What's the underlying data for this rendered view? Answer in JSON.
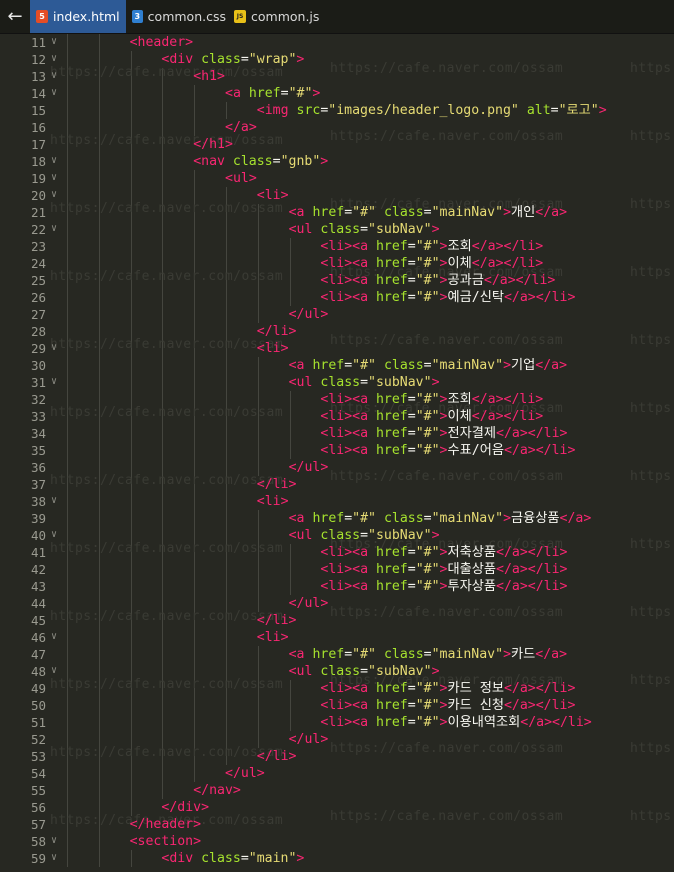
{
  "nav": {
    "back_glyph": "←"
  },
  "tabs": [
    {
      "name": "index.html",
      "icon": "html5-icon",
      "color": "#e44d26",
      "active": true
    },
    {
      "name": "common.css",
      "icon": "css3-icon",
      "color": "#2f7fd0",
      "active": false
    },
    {
      "name": "common.js",
      "icon": "js-icon",
      "color": "#e8c018",
      "active": false
    }
  ],
  "watermark": "https://cafe.naver.com/ossam",
  "colors": {
    "background": "#272822",
    "tag": "#f92672",
    "attribute": "#a6e22e",
    "string": "#e6db74",
    "text": "#f8f8f2",
    "active_tab": "#2d5a96"
  },
  "lines": [
    {
      "no": "11",
      "indent": 2,
      "fold": true,
      "tokens": [
        [
          "t",
          "<header>"
        ]
      ]
    },
    {
      "no": "12",
      "indent": 3,
      "fold": true,
      "tokens": [
        [
          "t",
          "<div"
        ],
        [
          "p",
          " "
        ],
        [
          "a",
          "class"
        ],
        [
          "p",
          "="
        ],
        [
          "s",
          "\"wrap\""
        ],
        [
          "t",
          ">"
        ]
      ]
    },
    {
      "no": "13",
      "indent": 4,
      "fold": true,
      "tokens": [
        [
          "t",
          "<h1>"
        ]
      ]
    },
    {
      "no": "14",
      "indent": 5,
      "fold": true,
      "tokens": [
        [
          "t",
          "<a"
        ],
        [
          "p",
          " "
        ],
        [
          "a",
          "href"
        ],
        [
          "p",
          "="
        ],
        [
          "s",
          "\"#\""
        ],
        [
          "t",
          ">"
        ]
      ]
    },
    {
      "no": "15",
      "indent": 6,
      "fold": false,
      "tokens": [
        [
          "t",
          "<img"
        ],
        [
          "p",
          " "
        ],
        [
          "a",
          "src"
        ],
        [
          "p",
          "="
        ],
        [
          "s",
          "\"images/header_logo.png\""
        ],
        [
          "p",
          " "
        ],
        [
          "a",
          "alt"
        ],
        [
          "p",
          "="
        ],
        [
          "s",
          "\"로고\""
        ],
        [
          "t",
          ">"
        ]
      ]
    },
    {
      "no": "16",
      "indent": 5,
      "fold": false,
      "tokens": [
        [
          "t",
          "</a>"
        ]
      ]
    },
    {
      "no": "17",
      "indent": 4,
      "fold": false,
      "tokens": [
        [
          "t",
          "</h1>"
        ]
      ]
    },
    {
      "no": "18",
      "indent": 4,
      "fold": true,
      "tokens": [
        [
          "t",
          "<nav"
        ],
        [
          "p",
          " "
        ],
        [
          "a",
          "class"
        ],
        [
          "p",
          "="
        ],
        [
          "s",
          "\"gnb\""
        ],
        [
          "t",
          ">"
        ]
      ]
    },
    {
      "no": "19",
      "indent": 5,
      "fold": true,
      "tokens": [
        [
          "t",
          "<ul>"
        ]
      ]
    },
    {
      "no": "20",
      "indent": 6,
      "fold": true,
      "tokens": [
        [
          "t",
          "<li>"
        ]
      ]
    },
    {
      "no": "21",
      "indent": 7,
      "fold": false,
      "tokens": [
        [
          "t",
          "<a"
        ],
        [
          "p",
          " "
        ],
        [
          "a",
          "href"
        ],
        [
          "p",
          "="
        ],
        [
          "s",
          "\"#\""
        ],
        [
          "p",
          " "
        ],
        [
          "a",
          "class"
        ],
        [
          "p",
          "="
        ],
        [
          "s",
          "\"mainNav\""
        ],
        [
          "t",
          ">"
        ],
        [
          "h",
          "개인"
        ],
        [
          "t",
          "</a>"
        ]
      ]
    },
    {
      "no": "22",
      "indent": 7,
      "fold": true,
      "tokens": [
        [
          "t",
          "<ul"
        ],
        [
          "p",
          " "
        ],
        [
          "a",
          "class"
        ],
        [
          "p",
          "="
        ],
        [
          "s",
          "\"subNav\""
        ],
        [
          "t",
          ">"
        ]
      ]
    },
    {
      "no": "23",
      "indent": 8,
      "fold": false,
      "tokens": [
        [
          "t",
          "<li><a"
        ],
        [
          "p",
          " "
        ],
        [
          "a",
          "href"
        ],
        [
          "p",
          "="
        ],
        [
          "s",
          "\"#\""
        ],
        [
          "t",
          ">"
        ],
        [
          "h",
          "조회"
        ],
        [
          "t",
          "</a></li>"
        ]
      ]
    },
    {
      "no": "24",
      "indent": 8,
      "fold": false,
      "tokens": [
        [
          "t",
          "<li><a"
        ],
        [
          "p",
          " "
        ],
        [
          "a",
          "href"
        ],
        [
          "p",
          "="
        ],
        [
          "s",
          "\"#\""
        ],
        [
          "t",
          ">"
        ],
        [
          "h",
          "이체"
        ],
        [
          "t",
          "</a></li>"
        ]
      ]
    },
    {
      "no": "25",
      "indent": 8,
      "fold": false,
      "tokens": [
        [
          "t",
          "<li><a"
        ],
        [
          "p",
          " "
        ],
        [
          "a",
          "href"
        ],
        [
          "p",
          "="
        ],
        [
          "s",
          "\"#\""
        ],
        [
          "t",
          ">"
        ],
        [
          "h",
          "공과금"
        ],
        [
          "t",
          "</a></li>"
        ]
      ]
    },
    {
      "no": "26",
      "indent": 8,
      "fold": false,
      "tokens": [
        [
          "t",
          "<li><a"
        ],
        [
          "p",
          " "
        ],
        [
          "a",
          "href"
        ],
        [
          "p",
          "="
        ],
        [
          "s",
          "\"#\""
        ],
        [
          "t",
          ">"
        ],
        [
          "h",
          "예금/신탁"
        ],
        [
          "t",
          "</a></li>"
        ]
      ]
    },
    {
      "no": "27",
      "indent": 7,
      "fold": false,
      "tokens": [
        [
          "t",
          "</ul>"
        ]
      ]
    },
    {
      "no": "28",
      "indent": 6,
      "fold": false,
      "tokens": [
        [
          "t",
          "</li>"
        ]
      ]
    },
    {
      "no": "29",
      "indent": 6,
      "fold": true,
      "tokens": [
        [
          "t",
          "<li>"
        ]
      ]
    },
    {
      "no": "30",
      "indent": 7,
      "fold": false,
      "tokens": [
        [
          "t",
          "<a"
        ],
        [
          "p",
          " "
        ],
        [
          "a",
          "href"
        ],
        [
          "p",
          "="
        ],
        [
          "s",
          "\"#\""
        ],
        [
          "p",
          " "
        ],
        [
          "a",
          "class"
        ],
        [
          "p",
          "="
        ],
        [
          "s",
          "\"mainNav\""
        ],
        [
          "t",
          ">"
        ],
        [
          "h",
          "기업"
        ],
        [
          "t",
          "</a>"
        ]
      ]
    },
    {
      "no": "31",
      "indent": 7,
      "fold": true,
      "tokens": [
        [
          "t",
          "<ul"
        ],
        [
          "p",
          " "
        ],
        [
          "a",
          "class"
        ],
        [
          "p",
          "="
        ],
        [
          "s",
          "\"subNav\""
        ],
        [
          "t",
          ">"
        ]
      ]
    },
    {
      "no": "32",
      "indent": 8,
      "fold": false,
      "tokens": [
        [
          "t",
          "<li><a"
        ],
        [
          "p",
          " "
        ],
        [
          "a",
          "href"
        ],
        [
          "p",
          "="
        ],
        [
          "s",
          "\"#\""
        ],
        [
          "t",
          ">"
        ],
        [
          "h",
          "조회"
        ],
        [
          "t",
          "</a></li>"
        ]
      ]
    },
    {
      "no": "33",
      "indent": 8,
      "fold": false,
      "tokens": [
        [
          "t",
          "<li><a"
        ],
        [
          "p",
          " "
        ],
        [
          "a",
          "href"
        ],
        [
          "p",
          "="
        ],
        [
          "s",
          "\"#\""
        ],
        [
          "t",
          ">"
        ],
        [
          "h",
          "이체"
        ],
        [
          "t",
          "</a></li>"
        ]
      ]
    },
    {
      "no": "34",
      "indent": 8,
      "fold": false,
      "tokens": [
        [
          "t",
          "<li><a"
        ],
        [
          "p",
          " "
        ],
        [
          "a",
          "href"
        ],
        [
          "p",
          "="
        ],
        [
          "s",
          "\"#\""
        ],
        [
          "t",
          ">"
        ],
        [
          "h",
          "전자결제"
        ],
        [
          "t",
          "</a></li>"
        ]
      ]
    },
    {
      "no": "35",
      "indent": 8,
      "fold": false,
      "tokens": [
        [
          "t",
          "<li><a"
        ],
        [
          "p",
          " "
        ],
        [
          "a",
          "href"
        ],
        [
          "p",
          "="
        ],
        [
          "s",
          "\"#\""
        ],
        [
          "t",
          ">"
        ],
        [
          "h",
          "수표/어음"
        ],
        [
          "t",
          "</a></li>"
        ]
      ]
    },
    {
      "no": "36",
      "indent": 7,
      "fold": false,
      "tokens": [
        [
          "t",
          "</ul>"
        ]
      ]
    },
    {
      "no": "37",
      "indent": 6,
      "fold": false,
      "tokens": [
        [
          "t",
          "</li>"
        ]
      ]
    },
    {
      "no": "38",
      "indent": 6,
      "fold": true,
      "tokens": [
        [
          "t",
          "<li>"
        ]
      ]
    },
    {
      "no": "39",
      "indent": 7,
      "fold": false,
      "tokens": [
        [
          "t",
          "<a"
        ],
        [
          "p",
          " "
        ],
        [
          "a",
          "href"
        ],
        [
          "p",
          "="
        ],
        [
          "s",
          "\"#\""
        ],
        [
          "p",
          " "
        ],
        [
          "a",
          "class"
        ],
        [
          "p",
          "="
        ],
        [
          "s",
          "\"mainNav\""
        ],
        [
          "t",
          ">"
        ],
        [
          "h",
          "금융상품"
        ],
        [
          "t",
          "</a>"
        ]
      ]
    },
    {
      "no": "40",
      "indent": 7,
      "fold": true,
      "tokens": [
        [
          "t",
          "<ul"
        ],
        [
          "p",
          " "
        ],
        [
          "a",
          "class"
        ],
        [
          "p",
          "="
        ],
        [
          "s",
          "\"subNav\""
        ],
        [
          "t",
          ">"
        ]
      ]
    },
    {
      "no": "41",
      "indent": 8,
      "fold": false,
      "tokens": [
        [
          "t",
          "<li><a"
        ],
        [
          "p",
          " "
        ],
        [
          "a",
          "href"
        ],
        [
          "p",
          "="
        ],
        [
          "s",
          "\"#\""
        ],
        [
          "t",
          ">"
        ],
        [
          "h",
          "저축상품"
        ],
        [
          "t",
          "</a></li>"
        ]
      ]
    },
    {
      "no": "42",
      "indent": 8,
      "fold": false,
      "tokens": [
        [
          "t",
          "<li><a"
        ],
        [
          "p",
          " "
        ],
        [
          "a",
          "href"
        ],
        [
          "p",
          "="
        ],
        [
          "s",
          "\"#\""
        ],
        [
          "t",
          ">"
        ],
        [
          "h",
          "대출상품"
        ],
        [
          "t",
          "</a></li>"
        ]
      ]
    },
    {
      "no": "43",
      "indent": 8,
      "fold": false,
      "tokens": [
        [
          "t",
          "<li><a"
        ],
        [
          "p",
          " "
        ],
        [
          "a",
          "href"
        ],
        [
          "p",
          "="
        ],
        [
          "s",
          "\"#\""
        ],
        [
          "t",
          ">"
        ],
        [
          "h",
          "투자상품"
        ],
        [
          "t",
          "</a></li>"
        ]
      ]
    },
    {
      "no": "44",
      "indent": 7,
      "fold": false,
      "tokens": [
        [
          "t",
          "</ul>"
        ]
      ]
    },
    {
      "no": "45",
      "indent": 6,
      "fold": false,
      "tokens": [
        [
          "t",
          "</li>"
        ]
      ]
    },
    {
      "no": "46",
      "indent": 6,
      "fold": true,
      "tokens": [
        [
          "t",
          "<li>"
        ]
      ]
    },
    {
      "no": "47",
      "indent": 7,
      "fold": false,
      "tokens": [
        [
          "t",
          "<a"
        ],
        [
          "p",
          " "
        ],
        [
          "a",
          "href"
        ],
        [
          "p",
          "="
        ],
        [
          "s",
          "\"#\""
        ],
        [
          "p",
          " "
        ],
        [
          "a",
          "class"
        ],
        [
          "p",
          "="
        ],
        [
          "s",
          "\"mainNav\""
        ],
        [
          "t",
          ">"
        ],
        [
          "h",
          "카드"
        ],
        [
          "t",
          "</a>"
        ]
      ]
    },
    {
      "no": "48",
      "indent": 7,
      "fold": true,
      "tokens": [
        [
          "t",
          "<ul"
        ],
        [
          "p",
          " "
        ],
        [
          "a",
          "class"
        ],
        [
          "p",
          "="
        ],
        [
          "s",
          "\"subNav\""
        ],
        [
          "t",
          ">"
        ]
      ]
    },
    {
      "no": "49",
      "indent": 8,
      "fold": false,
      "tokens": [
        [
          "t",
          "<li><a"
        ],
        [
          "p",
          " "
        ],
        [
          "a",
          "href"
        ],
        [
          "p",
          "="
        ],
        [
          "s",
          "\"#\""
        ],
        [
          "t",
          ">"
        ],
        [
          "h",
          "카드 정보"
        ],
        [
          "t",
          "</a></li>"
        ]
      ]
    },
    {
      "no": "50",
      "indent": 8,
      "fold": false,
      "tokens": [
        [
          "t",
          "<li><a"
        ],
        [
          "p",
          " "
        ],
        [
          "a",
          "href"
        ],
        [
          "p",
          "="
        ],
        [
          "s",
          "\"#\""
        ],
        [
          "t",
          ">"
        ],
        [
          "h",
          "카드 신청"
        ],
        [
          "t",
          "</a></li>"
        ]
      ]
    },
    {
      "no": "51",
      "indent": 8,
      "fold": false,
      "tokens": [
        [
          "t",
          "<li><a"
        ],
        [
          "p",
          " "
        ],
        [
          "a",
          "href"
        ],
        [
          "p",
          "="
        ],
        [
          "s",
          "\"#\""
        ],
        [
          "t",
          ">"
        ],
        [
          "h",
          "이용내역조회"
        ],
        [
          "t",
          "</a></li>"
        ]
      ]
    },
    {
      "no": "52",
      "indent": 7,
      "fold": false,
      "tokens": [
        [
          "t",
          "</ul>"
        ]
      ]
    },
    {
      "no": "53",
      "indent": 6,
      "fold": false,
      "tokens": [
        [
          "t",
          "</li>"
        ]
      ]
    },
    {
      "no": "54",
      "indent": 5,
      "fold": false,
      "tokens": [
        [
          "t",
          "</ul>"
        ]
      ]
    },
    {
      "no": "55",
      "indent": 4,
      "fold": false,
      "tokens": [
        [
          "t",
          "</nav>"
        ]
      ]
    },
    {
      "no": "56",
      "indent": 3,
      "fold": false,
      "tokens": [
        [
          "t",
          "</div>"
        ]
      ]
    },
    {
      "no": "57",
      "indent": 2,
      "fold": false,
      "tokens": [
        [
          "t",
          "</header>"
        ]
      ]
    },
    {
      "no": "58",
      "indent": 2,
      "fold": true,
      "tokens": [
        [
          "t",
          "<section>"
        ]
      ]
    },
    {
      "no": "59",
      "indent": 3,
      "fold": true,
      "tokens": [
        [
          "t",
          "<div"
        ],
        [
          "p",
          " "
        ],
        [
          "a",
          "class"
        ],
        [
          "p",
          "="
        ],
        [
          "s",
          "\"main\""
        ],
        [
          "t",
          ">"
        ]
      ]
    }
  ]
}
